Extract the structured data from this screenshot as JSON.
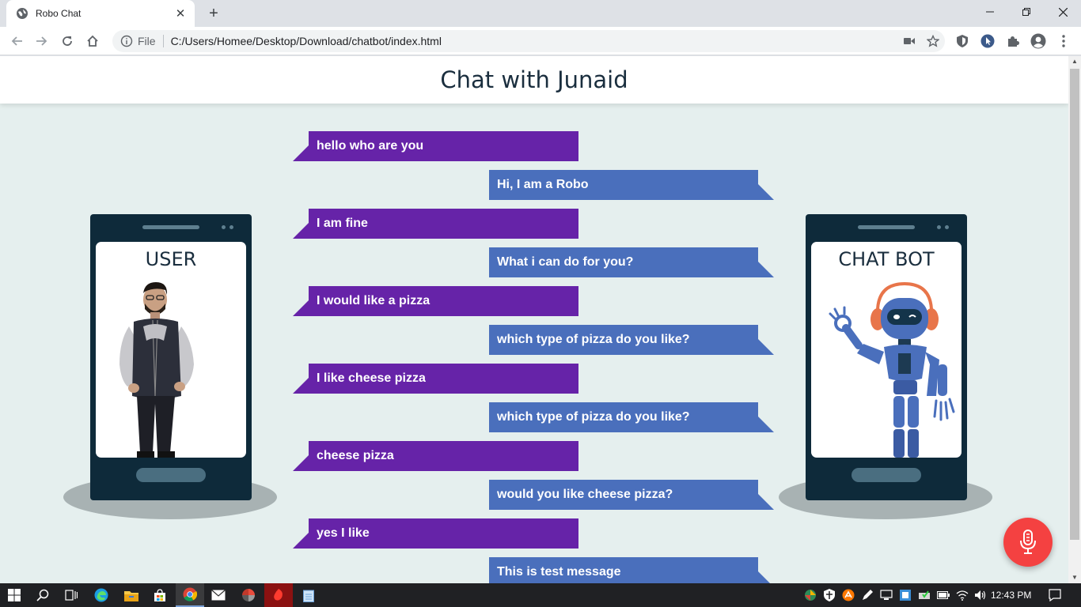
{
  "browser": {
    "tab_title": "Robo Chat",
    "tab_close": "✕",
    "new_tab": "+",
    "address_scheme": "File",
    "address_url": "C:/Users/Homee/Desktop/Download/chatbot/index.html"
  },
  "page": {
    "heading": "Chat with Junaid",
    "user_label": "USER",
    "bot_label": "CHAT BOT"
  },
  "messages": [
    {
      "sender": "user",
      "text": "hello who are you"
    },
    {
      "sender": "bot",
      "text": "Hi, I am a Robo"
    },
    {
      "sender": "user",
      "text": "I am fine"
    },
    {
      "sender": "bot",
      "text": "What i can do for you?"
    },
    {
      "sender": "user",
      "text": "I would like a pizza"
    },
    {
      "sender": "bot",
      "text": "which type of pizza do you like?"
    },
    {
      "sender": "user",
      "text": "I like cheese pizza"
    },
    {
      "sender": "bot",
      "text": "which type of pizza do you like?"
    },
    {
      "sender": "user",
      "text": "cheese pizza"
    },
    {
      "sender": "bot",
      "text": "would you like cheese pizza?"
    },
    {
      "sender": "user",
      "text": "yes I like"
    },
    {
      "sender": "bot",
      "text": "This is test message"
    }
  ],
  "colors": {
    "user_bubble": "#6623a8",
    "bot_bubble": "#4a6fbc",
    "page_bg": "#e5efee",
    "mic_button": "#f44141"
  },
  "taskbar": {
    "clock": "12:43 PM"
  }
}
